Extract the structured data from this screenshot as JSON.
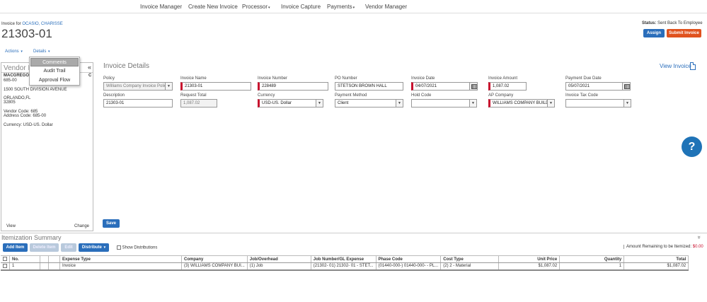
{
  "nav": {
    "items": [
      "Invoice Manager",
      "Create New Invoice",
      "Processor",
      "Invoice Capture",
      "Payments",
      "Vendor Manager"
    ],
    "caret": "▾"
  },
  "header": {
    "invoice_for_label": "Invoice for",
    "employee_name": "OCASIO, CHARISSE",
    "invoice_number": "21303-01",
    "status_label": "Status:",
    "status_value": "Sent Back To Employee",
    "assign_label": "Assign",
    "submit_label": "Submit Invoice"
  },
  "menus": {
    "actions_label": "Actions",
    "details_label": "Details",
    "details_items": [
      "Comments",
      "Audit Trail",
      "Approval Flow"
    ]
  },
  "vendor": {
    "title": "Vendor Info",
    "collapse_glyph": "«",
    "name_visible": "MACGREGOR",
    "name_suffix": "C",
    "id_line": "685-00",
    "address1": "1500 SOUTH DIVISION AVENUE",
    "city_state": "ORLANDO,FL",
    "zip": "32805",
    "vendor_code": "Vendor Code: 685",
    "address_code": "Address Code: 685-00",
    "currency": "Currency: USD-US. Dollar",
    "view_label": "View",
    "change_label": "Change"
  },
  "details": {
    "title": "Invoice Details",
    "view_invoice_label": "View Invoice",
    "fields": {
      "policy": {
        "label": "Policy",
        "value": "Williams Company Invoice Polic"
      },
      "invoice_name": {
        "label": "Invoice Name",
        "value": "21303-01"
      },
      "invoice_number": {
        "label": "Invoice Number",
        "value": "228489"
      },
      "po_number": {
        "label": "PO Number",
        "value": "STETSON BROWN HALL"
      },
      "invoice_date": {
        "label": "Invoice Date",
        "value": "04/07/2021"
      },
      "invoice_amount": {
        "label": "Invoice Amount",
        "value": "1,087.02"
      },
      "payment_due_date": {
        "label": "Payment Due Date",
        "value": "05/07/2021"
      },
      "description": {
        "label": "Description",
        "value": "21303-01"
      },
      "request_total": {
        "label": "Request Total",
        "value": "1,087.02"
      },
      "currency": {
        "label": "Currency",
        "value": "USD-US. Dollar"
      },
      "payment_method": {
        "label": "Payment Method",
        "value": "Client"
      },
      "hold_code": {
        "label": "Hold Code",
        "value": ""
      },
      "ap_company": {
        "label": "AP Company",
        "value": "WILLIAMS COMPANY BUILD"
      },
      "invoice_tax_code": {
        "label": "Invoice Tax Code",
        "value": ""
      }
    },
    "save_label": "Save",
    "select_glyph": "▼"
  },
  "itemization": {
    "title": "Itemization Summary",
    "expand_glyph": "»",
    "add_item": "Add Item",
    "delete_item": "Delete Item",
    "edit": "Edit",
    "distribute": "Distribute",
    "show_distributions": "Show Distributions",
    "amount_remaining_label": "Amount Remaining to be Itemized:",
    "amount_remaining_value": "$0.00",
    "columns": [
      "No.",
      "Expense Type",
      "Company",
      "Job/Overhead",
      "Job Number/GL Expense",
      "Phase Code",
      "Cost Type",
      "Unit Price",
      "Quantity",
      "Total"
    ],
    "rows": [
      {
        "no": "1",
        "expense_type": "Invoice",
        "company": "(3) WILLIAMS COMPANY BUI...",
        "job_overhead": "(1) Job",
        "job_number": "(21302- 01) 21302- 01 - STET...",
        "phase_code": "(01440-000-) 01440-000- - PL...",
        "cost_type": "(2) 2 - Material",
        "unit_price": "$1,087.02",
        "quantity": "1",
        "total": "$1,087.02"
      }
    ]
  },
  "help_glyph": "?",
  "colors": {
    "accent": "#2a6ebb",
    "submit": "#e0521e",
    "required": "#c8102e",
    "help": "#1f73b7"
  }
}
